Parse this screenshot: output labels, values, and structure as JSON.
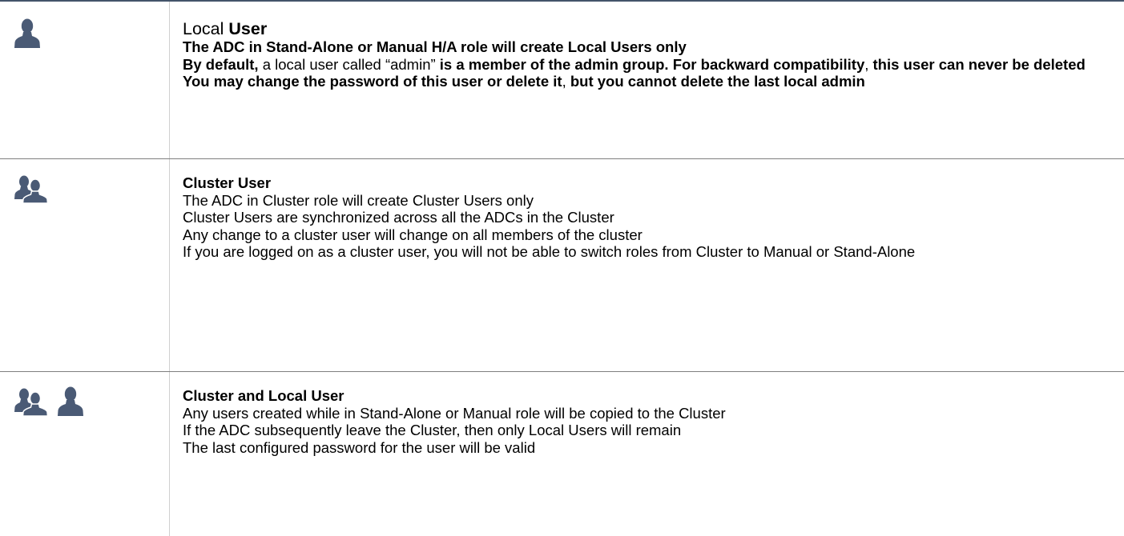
{
  "rows": [
    {
      "icon": "single-user-icon",
      "title_prefix": "Local ",
      "title_bold": "User",
      "line1": "The ADC in Stand-Alone or Manual H/A role will create Local Users only",
      "line2_bold_a": "By default,",
      "line2_normal": " a local user called “admin” ",
      "line2_bold_b": "is a member of the admin group. For backward compatibility",
      "line2_comma": ",",
      "line2_bold_c": " this user can never be deleted",
      "line3_bold_a": "You may change the password of this user or delete it",
      "line3_comma": ",",
      "line3_bold_b": " but you cannot delete the last local admin"
    },
    {
      "icon": "user-pair-icon",
      "title": "Cluster User",
      "lines": [
        "The ADC in Cluster role will create Cluster Users only",
        "Cluster Users are synchronized across all the ADCs in the Cluster",
        "Any change to a cluster user will change on all members of the cluster",
        "If you are logged on as a cluster user, you will not be able to switch roles from Cluster to Manual or Stand-Alone"
      ]
    },
    {
      "icon": "user-pair-and-single-user-icon",
      "title": "Cluster and Local User",
      "lines": [
        "Any users created while in Stand-Alone or Manual role will be copied to the Cluster",
        "If the ADC subsequently leave the Cluster, then only Local Users will remain",
        "The last configured password for the user will be valid"
      ]
    }
  ],
  "colors": {
    "icon": "#4a5a75",
    "top_rule": "#44546a",
    "row_rule": "#7f7f7f"
  }
}
